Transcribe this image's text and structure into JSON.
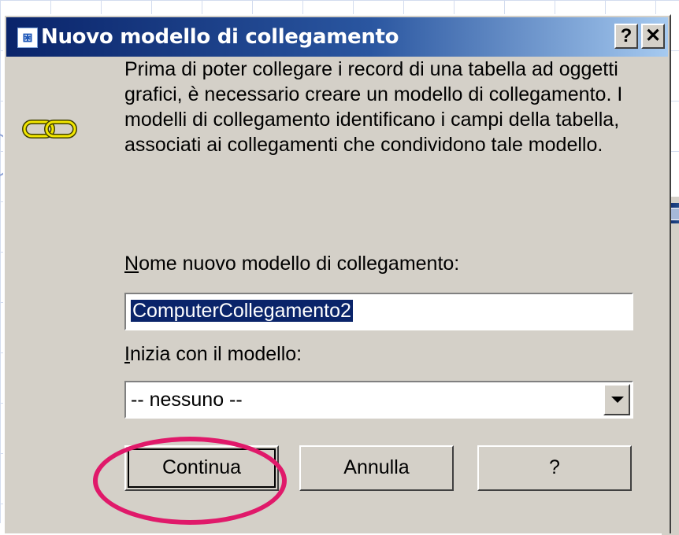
{
  "dialog": {
    "title": "Nuovo modello di collegamento",
    "title_icon": "link-template-icon",
    "help_button": "?",
    "close_button": "✕"
  },
  "intro_text": "Prima di poter collegare i record di una tabella ad oggetti grafici, è necessario creare un modello di collegamento. I modelli di collegamento identificano i campi della tabella, associati ai collegamenti che condividono tale modello.",
  "name_field": {
    "label_accel": "N",
    "label_rest": "ome nuovo modello di collegamento:",
    "value": "ComputerCollegamento2"
  },
  "start_field": {
    "label_accel": "I",
    "label_rest": "nizia con il modello:",
    "selected": "-- nessuno --"
  },
  "buttons": {
    "continue": "Continua",
    "cancel": "Annulla",
    "help": "?"
  },
  "colors": {
    "titlebar_start": "#0a246a",
    "dialog_bg": "#d4d0c8",
    "highlight": "#e0196a"
  }
}
